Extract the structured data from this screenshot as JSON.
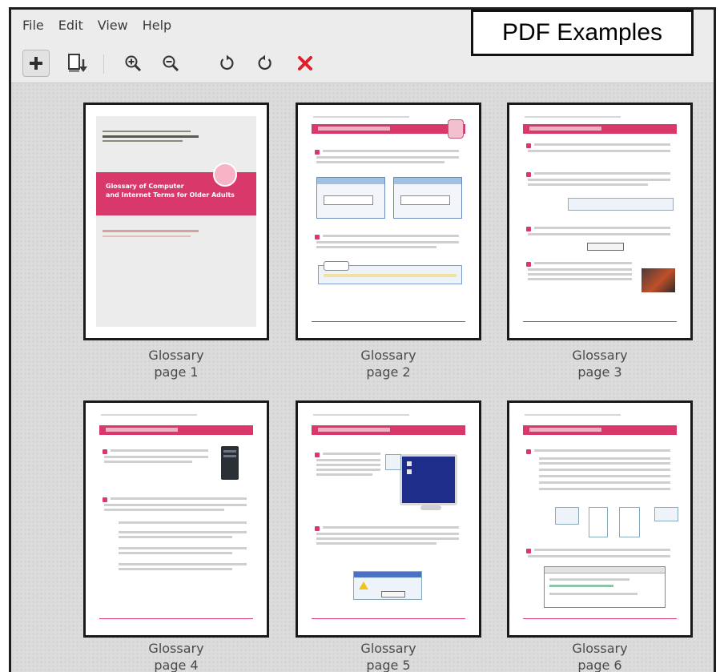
{
  "menu": [
    "File",
    "Edit",
    "View",
    "Help"
  ],
  "badge": "PDF Examples",
  "toolbar": {
    "icons": [
      "add-icon",
      "export-icon",
      "zoom-in-icon",
      "zoom-out-icon",
      "rotate-left-icon",
      "rotate-right-icon",
      "delete-icon"
    ],
    "delete_color": "#e0202a"
  },
  "pages": [
    {
      "name": "Glossary",
      "label": "page 1"
    },
    {
      "name": "Glossary",
      "label": "page 2"
    },
    {
      "name": "Glossary",
      "label": "page 3"
    },
    {
      "name": "Glossary",
      "label": "page 4"
    },
    {
      "name": "Glossary",
      "label": "page 5"
    },
    {
      "name": "Glossary",
      "label": "page 6"
    }
  ],
  "cover": {
    "title_line1": "Glossary of Computer",
    "title_line2": "and Internet Terms for Older Adults"
  },
  "colors": {
    "accent": "#d9386a",
    "badge_border": "#111111"
  }
}
